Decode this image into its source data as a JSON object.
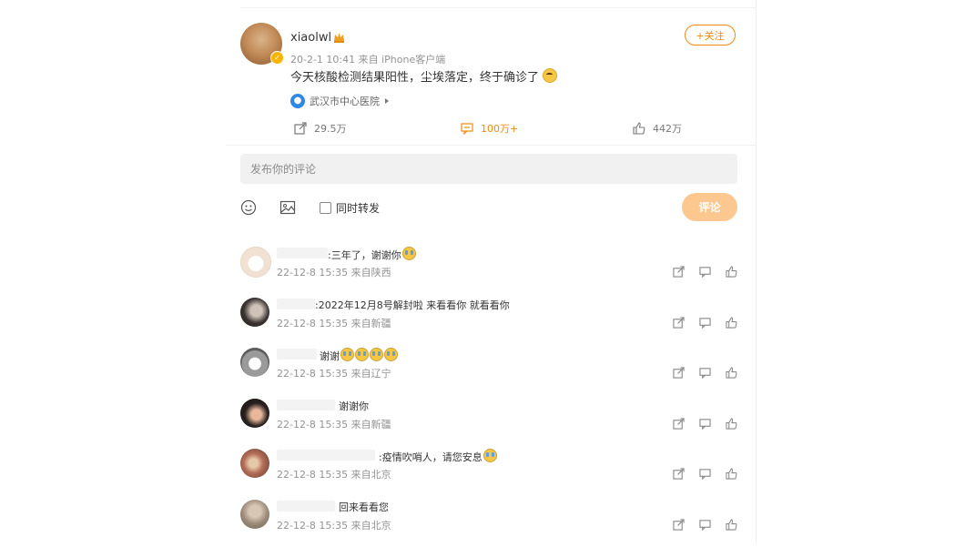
{
  "post": {
    "username": "xiaolwl",
    "meta": "20-2-1 10:41  来自 iPhone客户端",
    "text": "今天核酸检测结果阳性，尘埃落定，终于确诊了",
    "location": "武汉市中心医院",
    "follow_label": "+关注",
    "reposts": "29.5万",
    "comments": "100万+",
    "likes": "442万"
  },
  "colors": {
    "accent": "#f08a12",
    "submit_bg": "#fcc890",
    "location_pin": "#2f87e8",
    "meta": "#939393"
  },
  "composer": {
    "placeholder": "发布你的评论",
    "repost_label": "同时转发",
    "submit_label": "评论"
  },
  "comments": [
    {
      "text": ":三年了，谢谢你",
      "meta": "22-12-8 15:35 来自陕西",
      "emoji_count": 1
    },
    {
      "text": ":2022年12月8号解封啦 来看看你 就看看你",
      "meta": "22-12-8 15:35 来自新疆",
      "emoji_count": 0
    },
    {
      "text": "谢谢",
      "meta": "22-12-8 15:35 来自辽宁",
      "emoji_count": 4
    },
    {
      "text": "谢谢你",
      "meta": "22-12-8 15:35 来自新疆",
      "emoji_count": 0
    },
    {
      "text": ":疫情吹哨人，请您安息",
      "meta": "22-12-8 15:35 来自北京",
      "emoji_count": 1
    },
    {
      "text": "回来看看您",
      "meta": "22-12-8 15:35 来自北京",
      "emoji_count": 0
    }
  ]
}
